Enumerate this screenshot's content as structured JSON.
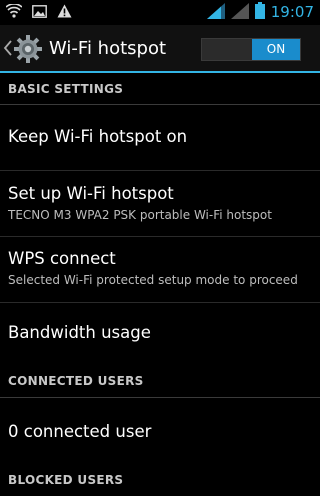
{
  "status_bar": {
    "time": "19:07",
    "left_icons": [
      "wifi-hotspot-icon",
      "image-icon",
      "warning-icon"
    ],
    "right_icons": [
      "signal-1-icon",
      "signal-2-icon",
      "battery-icon"
    ],
    "accent_color": "#33b5e5"
  },
  "action_bar": {
    "title": "Wi-Fi hotspot",
    "toggle_label": "ON",
    "toggle_state": true
  },
  "sections": [
    {
      "header": "BASIC SETTINGS",
      "items": [
        {
          "title": "Keep Wi-Fi hotspot on"
        },
        {
          "title": "Set up Wi-Fi hotspot",
          "subtitle": "TECNO M3 WPA2 PSK portable Wi-Fi hotspot"
        },
        {
          "title": "WPS connect",
          "subtitle": "Selected Wi-Fi protected setup mode to proceed"
        },
        {
          "title": "Bandwidth usage"
        }
      ]
    },
    {
      "header": "CONNECTED USERS",
      "items": [
        {
          "title": "0 connected user"
        }
      ]
    },
    {
      "header": "BLOCKED USERS",
      "items": []
    }
  ]
}
